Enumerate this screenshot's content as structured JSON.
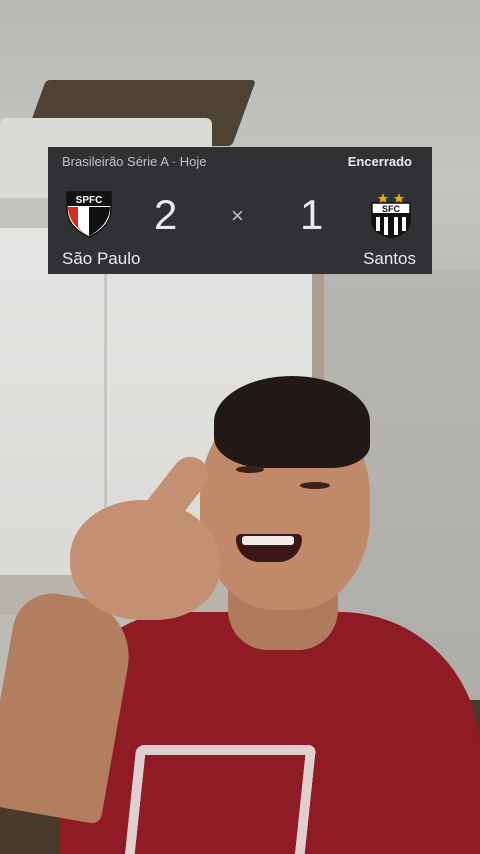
{
  "match": {
    "competition": "Brasileirão Série A · Hoje",
    "status": "Encerrado",
    "home": {
      "name": "São Paulo",
      "score": "2",
      "crest_text": "SPFC",
      "icon": "spfc-crest-icon"
    },
    "separator": "×",
    "away": {
      "name": "Santos",
      "score": "1",
      "crest_text": "SFC",
      "icon": "santos-crest-icon"
    }
  },
  "colors": {
    "card_background": "#303134",
    "card_text": "#e8eaed",
    "spfc_red": "#d52b1e",
    "shirt": "#8f1c24"
  }
}
